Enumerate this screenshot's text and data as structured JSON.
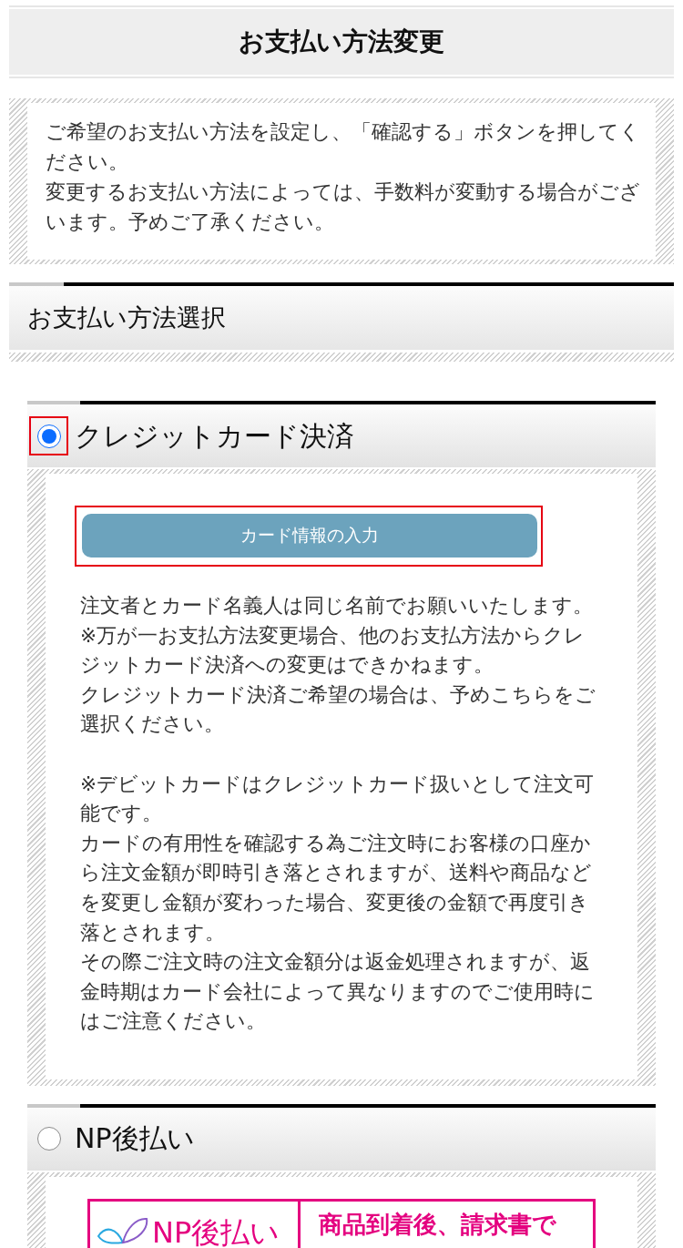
{
  "page_title": "お支払い方法変更",
  "intro": {
    "paragraphs": [
      "ご希望のお支払い方法を設定し、「確認する」ボタンを押してください。",
      "変更するお支払い方法によっては、手数料が変動する場合がございます。予めご了承ください。"
    ]
  },
  "section": {
    "title": "お支払い方法選択"
  },
  "payment_methods": [
    {
      "kind": "credit_card",
      "label": "クレジットカード決済",
      "selected": true,
      "highlighted": true,
      "button": {
        "label": "カード情報の入力",
        "highlighted": true
      },
      "note_groups": [
        {
          "paragraphs": [
            "注文者とカード名義人は同じ名前でお願いいたします。",
            "※万が一お支払方法変更場合、他のお支払方法からクレジットカード決済への変更はできかねます。",
            "クレジットカード決済ご希望の場合は、予めこちらをご選択ください。"
          ]
        },
        {
          "paragraphs": [
            "※デビットカードはクレジットカード扱いとして注文可能です。",
            "カードの有用性を確認する為ご注文時にお客様の口座から注文金額が即時引き落とされますが、送料や商品などを変更し金額が変わった場合、変更後の金額で再度引き落とされます。",
            "その際ご注文時の注文金額分は返金処理されますが、返金時期はカード会社によって異なりますのでご使用時にはご注意ください。"
          ]
        }
      ]
    },
    {
      "kind": "np",
      "label": "NP後払い",
      "selected": false,
      "highlighted": false,
      "banner": {
        "logo_text": "NP後払い",
        "headline": "商品到着後、請求書で"
      }
    }
  ]
}
